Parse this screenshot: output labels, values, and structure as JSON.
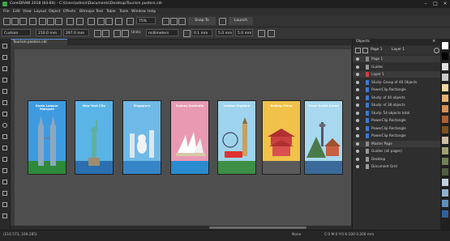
{
  "window": {
    "title": "CorelDRAW 2018 (64-Bit) - C:\\Users\\admin\\Documents\\Desktop\\Tourism posters.cdr",
    "controls": [
      "minimize-icon",
      "maximize-icon",
      "close-icon"
    ]
  },
  "menu": [
    "File",
    "Edit",
    "View",
    "Layout",
    "Object",
    "Effects",
    "Bitmaps",
    "Text",
    "Table",
    "Tools",
    "Window",
    "Help"
  ],
  "toolbar": {
    "zoom_value": "75%",
    "snap_label": "Snap To",
    "launch_label": "Launch"
  },
  "property_bar": {
    "page_size": "Custom",
    "width": "210.0 mm",
    "height": "297.0 mm",
    "units_label": "Units:",
    "units_value": "millimeters",
    "nudge_value": "0.1 mm",
    "dup_x": "5.0 mm",
    "dup_y": "5.0 mm"
  },
  "document_tab": "Tourism posters.cdr",
  "posters": [
    {
      "title": "Kuala Lumpur Malaysia",
      "scene": "twin-towers",
      "sky": "#3e9be0",
      "ground": "#2e8a3a"
    },
    {
      "title": "New York City",
      "scene": "statue-of-liberty",
      "sky": "#5ab4e6",
      "ground": "#2a6fb0"
    },
    {
      "title": "Singapore",
      "scene": "merlion",
      "sky": "#6fb9e8",
      "ground": "#3585c8"
    },
    {
      "title": "Sydney Australia",
      "scene": "opera-house",
      "sky": "#e89ab3",
      "ground": "#2a8bd0"
    },
    {
      "title": "London England",
      "scene": "big-ben",
      "sky": "#9ed4ee",
      "ground": "#3d8f46"
    },
    {
      "title": "Beijing China",
      "scene": "temple",
      "sky": "#f0c24a",
      "ground": "#5a5a5a"
    },
    {
      "title": "Seoul South Korea",
      "scene": "namsan-tower",
      "sky": "#a8d8ef",
      "ground": "#3a6a9a"
    }
  ],
  "objects_panel": {
    "title": "Objects",
    "page_label": "Page 1",
    "layer_label": "Layer 1",
    "rows": [
      {
        "text": "Page 1",
        "kind": "group",
        "color": "#888888"
      },
      {
        "text": "Guides",
        "kind": "item",
        "color": "#999999"
      },
      {
        "text": "Layer 1",
        "kind": "group",
        "color": "#d04040"
      },
      {
        "text": "Study: Group of 46 Objects",
        "kind": "item",
        "color": "#3a7ad6"
      },
      {
        "text": "PowerClip Rectangle",
        "kind": "item",
        "color": "#3a7ad6"
      },
      {
        "text": "Study: of 40 objects",
        "kind": "item",
        "color": "#3a7ad6"
      },
      {
        "text": "Study: of 38 objects",
        "kind": "item",
        "color": "#3a7ad6"
      },
      {
        "text": "Study: 54 objects total",
        "kind": "item",
        "color": "#3a7ad6"
      },
      {
        "text": "PowerClip Rectangle",
        "kind": "item",
        "color": "#3a7ad6"
      },
      {
        "text": "PowerClip Rectangle",
        "kind": "item",
        "color": "#3a7ad6"
      },
      {
        "text": "PowerClip Rectangle",
        "kind": "item",
        "color": "#3a7ad6"
      },
      {
        "text": "Master Page",
        "kind": "group",
        "color": "#888888"
      },
      {
        "text": "Guides (all pages)",
        "kind": "item",
        "color": "#999999"
      },
      {
        "text": "Desktop",
        "kind": "item",
        "color": "#999999"
      },
      {
        "text": "Document Grid",
        "kind": "item",
        "color": "#999999"
      }
    ]
  },
  "palette_colors": [
    "#ffffff",
    "#000000",
    "#e0e0e0",
    "#c8c8c8",
    "#f2d7a0",
    "#e8b070",
    "#d89050",
    "#b06030",
    "#805020",
    "#d0c0a0",
    "#a0a070",
    "#708050",
    "#506040",
    "#c0d0e0",
    "#90b0d0",
    "#6090c0",
    "#3060a0"
  ],
  "status": {
    "coords": "(216.573, 109.285)",
    "fill_label": "None",
    "outline_label": "C:0 M:0 Y:0 K:100  0.200 mm"
  }
}
